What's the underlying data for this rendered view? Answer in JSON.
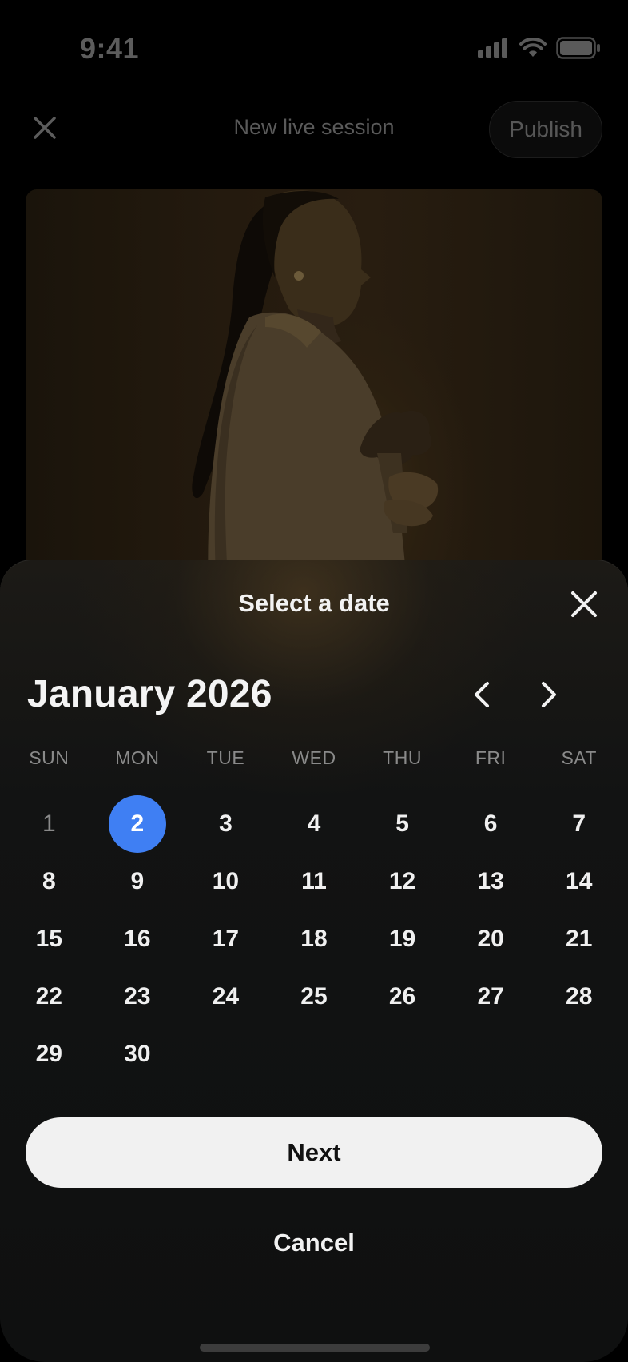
{
  "status_bar": {
    "time": "9:41",
    "icons": [
      "signal-icon",
      "wifi-icon",
      "battery-icon"
    ]
  },
  "header": {
    "close_icon": "close-icon",
    "title": "New live session",
    "publish_label": "Publish"
  },
  "photo": {
    "description_icon": "cover-photo"
  },
  "date_sheet": {
    "title": "Select a date",
    "close_icon": "close-icon",
    "month_label": "January 2026",
    "prev_icon": "chevron-left-icon",
    "next_icon": "chevron-right-icon",
    "weekdays": [
      "SUN",
      "MON",
      "TUE",
      "WED",
      "THU",
      "FRI",
      "SAT"
    ],
    "days": [
      "1",
      "2",
      "3",
      "4",
      "5",
      "6",
      "7",
      "8",
      "9",
      "10",
      "11",
      "12",
      "13",
      "14",
      "15",
      "16",
      "17",
      "18",
      "19",
      "20",
      "21",
      "22",
      "23",
      "24",
      "25",
      "26",
      "27",
      "28",
      "29",
      "30"
    ],
    "selected_day": "2",
    "muted_day": "1",
    "next_label": "Next",
    "cancel_label": "Cancel"
  },
  "colors": {
    "accent": "#3f7ff3",
    "sheet_bg": "#121313",
    "button_bg": "#f1f1f1"
  }
}
